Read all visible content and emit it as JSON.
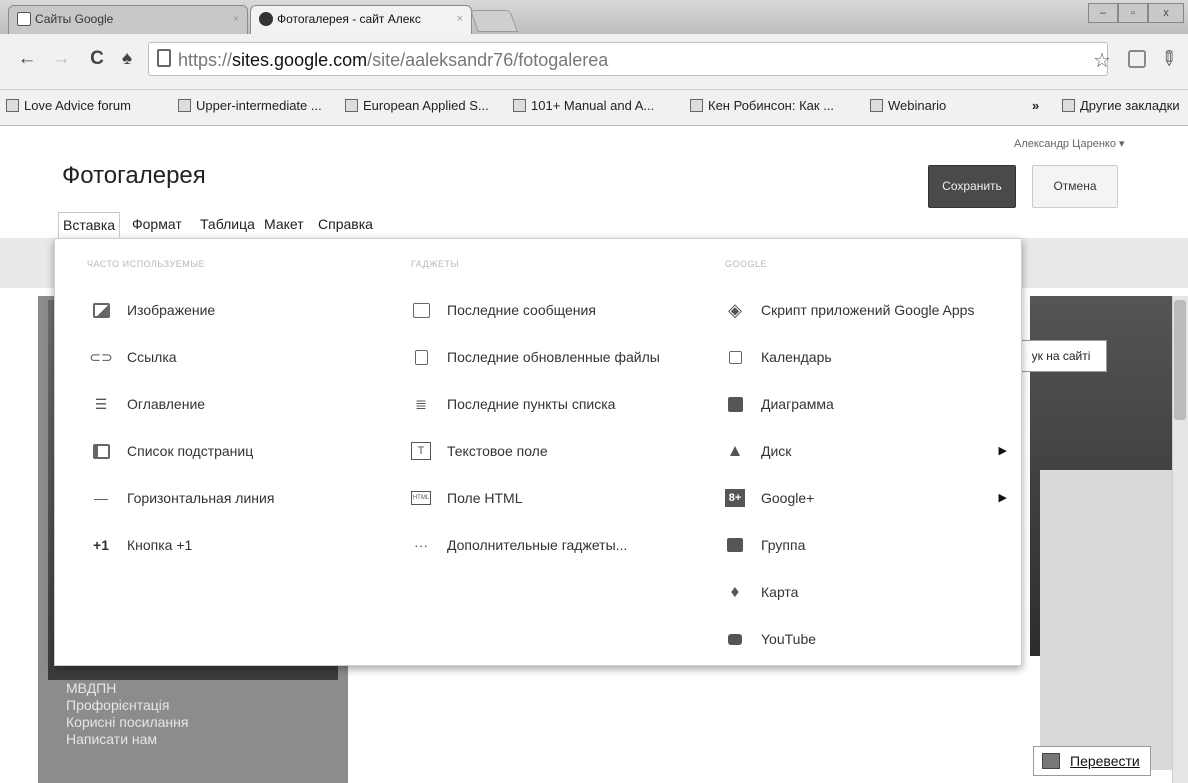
{
  "browser": {
    "tabs": [
      {
        "label": "Сайты Google"
      },
      {
        "label": "Фотогалерея - сайт Алекс"
      }
    ],
    "tab_close_symbol": "×",
    "window_buttons": [
      "–",
      "▫",
      "x"
    ],
    "url_prefix": "https://",
    "url_host": "sites.google.com",
    "url_path": "/site/aaleksandr76/fotogalerea",
    "nav": {
      "back": "←",
      "forward": "→",
      "reload": "C",
      "home": "♠"
    },
    "star": "☆",
    "wrench": "✎",
    "bookmarks": [
      "Love Advice forum",
      "Upper-intermediate ...",
      "European Applied S...",
      "101+ Manual and A...",
      "Кен Робинсон: Как ...",
      "Webinario"
    ],
    "bookmarks_more": "»",
    "other_bookmarks": "Другие закладки"
  },
  "page": {
    "title": "Фотогалерея",
    "user": "Александр Царенко ▾",
    "save_label": "Сохранить",
    "cancel_label": "Отмена",
    "menus": [
      "Вставка",
      "Формат",
      "Таблица",
      "Макет",
      "Справка"
    ],
    "search_site": "ук на сайті",
    "translate": "Перевести",
    "side_nav": [
      "МВДПН",
      "Профорієнтація",
      "Корисні посилання",
      "Написати нам"
    ]
  },
  "insert_menu": {
    "col1_heading": "ЧАСТО ИСПОЛЬЗУЕМЫЕ",
    "col2_heading": "ГАДЖЕТЫ",
    "col3_heading": "GOOGLE",
    "col1": [
      {
        "label": "Изображение",
        "icon": "image-icon"
      },
      {
        "label": "Ссылка",
        "icon": "link-icon"
      },
      {
        "label": "Оглавление",
        "icon": "toc-icon"
      },
      {
        "label": "Список подстраниц",
        "icon": "subpages-icon"
      },
      {
        "label": "Горизонтальная линия",
        "icon": "hr-icon"
      },
      {
        "label": "Кнопка +1",
        "icon": "plus-one-icon"
      }
    ],
    "col2": [
      {
        "label": "Последние сообщения",
        "icon": "recent-posts-icon"
      },
      {
        "label": "Последние обновленные файлы",
        "icon": "recent-files-icon"
      },
      {
        "label": "Последние пункты списка",
        "icon": "recent-list-icon"
      },
      {
        "label": "Текстовое поле",
        "icon": "textbox-icon"
      },
      {
        "label": "Поле HTML",
        "icon": "html-box-icon"
      },
      {
        "label": "Дополнительные гаджеты...",
        "icon": "more-gadgets-icon"
      }
    ],
    "col3": [
      {
        "label": "Скрипт приложений Google Apps",
        "icon": "apps-script-icon"
      },
      {
        "label": "Календарь",
        "icon": "calendar-icon"
      },
      {
        "label": "Диаграмма",
        "icon": "chart-icon"
      },
      {
        "label": "Диск",
        "icon": "drive-icon",
        "submenu": true
      },
      {
        "label": "Google+",
        "icon": "google-plus-icon",
        "submenu": true
      },
      {
        "label": "Группа",
        "icon": "groups-icon"
      },
      {
        "label": "Карта",
        "icon": "map-pin-icon"
      },
      {
        "label": "YouTube",
        "icon": "youtube-icon"
      }
    ],
    "submenu_arrow": "▶",
    "plus_one_glyph": "+1",
    "ellipsis_glyph": "···"
  }
}
